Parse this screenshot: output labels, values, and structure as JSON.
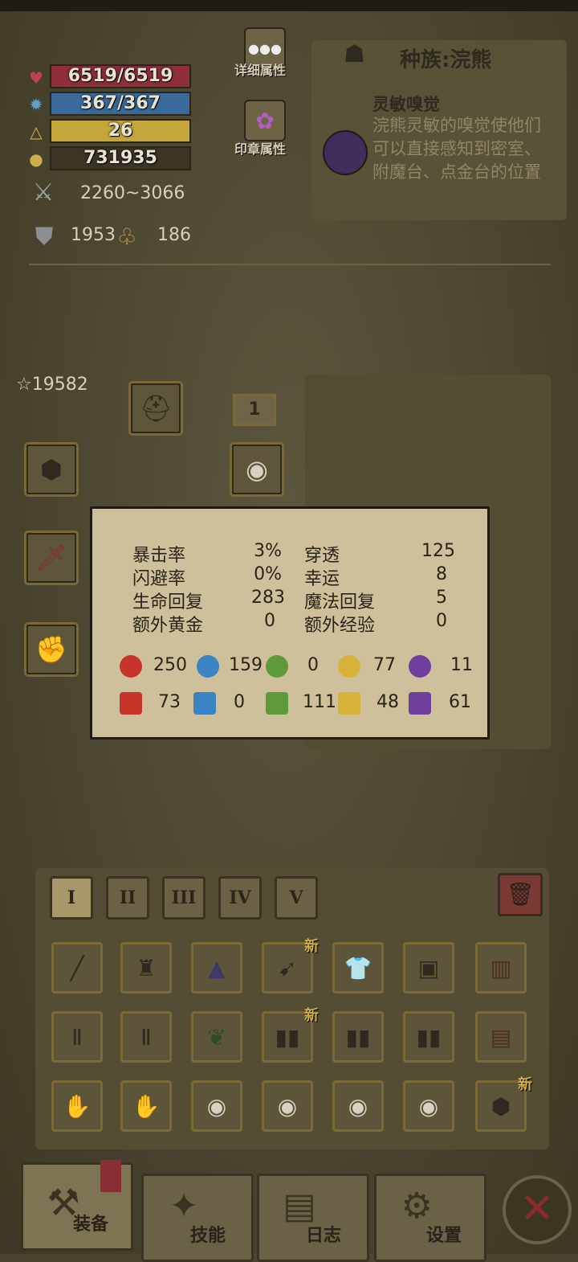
{
  "stats": {
    "hp": "6519/6519",
    "mp": "367/367",
    "level": "26",
    "gold": "731935",
    "attack": "2260~3066",
    "armor": "1953",
    "magic_resist": "186"
  },
  "buttons": {
    "detail_attrs": "详细属性",
    "seal_attrs": "印章属性"
  },
  "race": {
    "title": "种族:浣熊",
    "trait_name": "灵敏嗅觉",
    "trait_desc": "浣熊灵敏的嗅觉使他们可以直接感知到密室、附魔台、点金台的位置"
  },
  "equip": {
    "score": "19582",
    "slot_count": "1"
  },
  "popup": {
    "rows": [
      {
        "label_a": "暴击率",
        "val_a": "3%",
        "label_b": "穿透",
        "val_b": "125"
      },
      {
        "label_a": "闪避率",
        "val_a": "0%",
        "label_b": "幸运",
        "val_b": "8"
      },
      {
        "label_a": "生命回复",
        "val_a": "283",
        "label_b": "魔法回复",
        "val_b": "5"
      },
      {
        "label_a": "额外黄金",
        "val_a": "0",
        "label_b": "额外经验",
        "val_b": "0"
      }
    ],
    "attack_elements": [
      "250",
      "159",
      "0",
      "77",
      "11"
    ],
    "resist_elements": [
      "73",
      "0",
      "111",
      "48",
      "61"
    ]
  },
  "tiers": [
    "I",
    "II",
    "III",
    "IV",
    "V"
  ],
  "inventory_new_label": "新",
  "tabs": {
    "equip": "装备",
    "skills": "技能",
    "log": "日志",
    "settings": "设置"
  },
  "colors": {
    "hp": "#8e2f3a",
    "mp": "#3a6a9c",
    "xp": "#c4a63a",
    "gold_bar": "#2f2a1c",
    "fire": "#c7352a",
    "water": "#3b84c4",
    "nature": "#5f9a3a",
    "light": "#d7b23a",
    "shadow": "#6e3f9c"
  },
  "icons": {
    "heart": "heart-icon",
    "gear": "gear-icon",
    "triangle": "level-triangle-icon",
    "coins": "gold-coins-icon",
    "swords": "crossed-swords-icon",
    "shield": "shield-icon",
    "trash": "trash-icon",
    "close": "close-icon"
  }
}
